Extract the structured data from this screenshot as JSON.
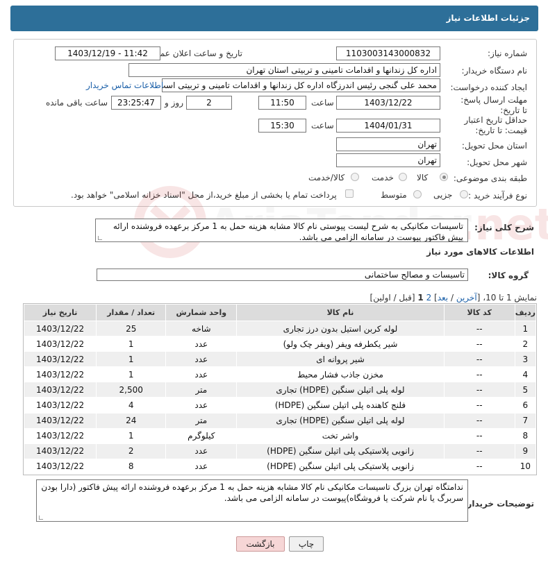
{
  "header": {
    "title": "جزئیات اطلاعات نیاز"
  },
  "form": {
    "need_number_label": "شماره نیاز:",
    "need_number": "1103003143000832",
    "announce_label": "تاریخ و ساعت اعلان عمومی:",
    "announce_value": "1403/12/19 - 11:42",
    "buyer_org_label": "نام دستگاه خریدار:",
    "buyer_org": "اداره کل زندانها و اقدامات تامینی و تربیتی استان تهران",
    "creator_label": "ایجاد کننده درخواست:",
    "creator": "محمد علی گنجی رئیس اندرزگاه  اداره کل زندانها و اقدامات تامینی و تربیتی است",
    "contact_link": "اطلاعات تماس خریدار",
    "reply_deadline_label": "مهلت ارسال پاسخ: تا تاریخ:",
    "reply_date": "1403/12/22",
    "time_label": "ساعت",
    "reply_time": "11:50",
    "days_value": "2",
    "days_label": "روز و",
    "remaining_value": "23:25:47",
    "remaining_label": "ساعت باقی مانده",
    "price_validity_label": "حداقل تاریخ اعتبار قیمت: تا تاریخ:",
    "price_date": "1404/01/31",
    "price_time": "15:30",
    "province_label": "استان محل تحویل:",
    "province": "تهران",
    "city_label": "شهر محل تحویل:",
    "city": "تهران",
    "category_label": "طبقه بندی موضوعی:",
    "category_options": [
      "کالا",
      "خدمت",
      "کالا/خدمت"
    ],
    "category_selected": "کالا",
    "process_label": "نوع فرآیند خرید :",
    "process_options": [
      "جزیی",
      "متوسط"
    ],
    "payment_note": "پرداخت تمام یا بخشی از مبلغ خرید،از محل \"اسناد خزانه اسلامی\" خواهد بود."
  },
  "summary": {
    "label": "شرح کلی نیاز:",
    "text": "تاسیسات مکانیکی به شرح لیست پیوستی نام کالا مشابه هزینه حمل به 1 مرکز برعهده فروشنده ارائه پیش فاکتور پیوست در سامانه الزامی می باشد."
  },
  "goods_section": {
    "title": "اطلاعات کالاهای مورد نیاز",
    "group_label": "گروه کالا:",
    "group_value": "تاسیسات و مصالح ساختمانی",
    "paging_prefix": "نمایش 1 تا 10،",
    "paging_last": "آخرین",
    "paging_next": "بعد",
    "paging_page2": "2",
    "paging_current": "1",
    "paging_suffix": "[قبل / اولین]"
  },
  "table": {
    "headers": [
      "ردیف",
      "کد کالا",
      "نام کالا",
      "واحد شمارش",
      "تعداد / مقدار",
      "تاریخ نیاز"
    ],
    "rows": [
      [
        "1",
        "--",
        "لوله کربن استیل بدون درز تجاری",
        "شاخه",
        "25",
        "1403/12/22"
      ],
      [
        "2",
        "--",
        "شیر یکطرفه ویفر (ویفر چک ولو)",
        "عدد",
        "1",
        "1403/12/22"
      ],
      [
        "3",
        "--",
        "شیر پروانه ای",
        "عدد",
        "1",
        "1403/12/22"
      ],
      [
        "4",
        "--",
        "مخزن جاذب فشار محیط",
        "عدد",
        "1",
        "1403/12/22"
      ],
      [
        "5",
        "--",
        "لوله پلی اتیلن سنگین (HDPE) تجاری",
        "متر",
        "2,500",
        "1403/12/22"
      ],
      [
        "6",
        "--",
        "فلنج کاهنده پلی اتیلن سنگین (HDPE)",
        "عدد",
        "4",
        "1403/12/22"
      ],
      [
        "7",
        "--",
        "لوله پلی اتیلن سنگین (HDPE) تجاری",
        "متر",
        "24",
        "1403/12/22"
      ],
      [
        "8",
        "--",
        "واشر تخت",
        "کیلوگرم",
        "1",
        "1403/12/22"
      ],
      [
        "9",
        "--",
        "زانویی پلاستیکی پلی اتیلن سنگین (HDPE)",
        "عدد",
        "2",
        "1403/12/22"
      ],
      [
        "10",
        "--",
        "زانویی پلاستیکی پلی اتیلن سنگین (HDPE)",
        "عدد",
        "8",
        "1403/12/22"
      ]
    ]
  },
  "buyer_notes": {
    "label": "توضیحات خریدار:",
    "text": "ندامتگاه تهران بزرگ تاسیسات مکانیکی نام کالا مشابه هزینه حمل به 1 مرکز برعهده فروشنده ارائه پیش فاکتور (دارا بودن سربرگ یا نام شرکت یا فروشگاه)پیوست در سامانه الزامی می باشد."
  },
  "buttons": {
    "print": "چاپ",
    "back": "بازگشت"
  },
  "watermark_text": "AriaTender.net",
  "colors": {
    "title_bar": "#2d6f99",
    "link": "#1a5fa8",
    "back_button": "#f6d6d6"
  }
}
